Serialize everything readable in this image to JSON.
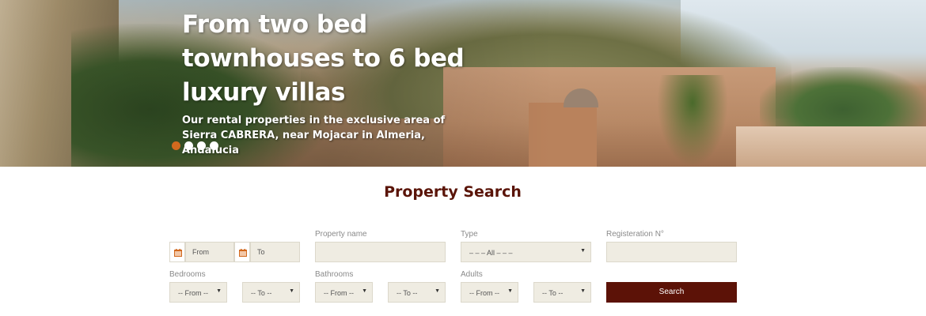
{
  "hero": {
    "title": "From two bed townhouses to 6 bed luxury villas",
    "subtitle": "Our rental properties in the exclusive area of Sierra CABRERA, near Mojacar in Almeria, Andalucia",
    "slides_total": 4,
    "active_slide": 1,
    "dot_active_color": "#d2691e"
  },
  "search": {
    "title": "Property Search",
    "date_from_placeholder": "From",
    "date_to_placeholder": "To",
    "property_name_label": "Property name",
    "property_name_value": "",
    "type_label": "Type",
    "type_value": "– – – All – – –",
    "registration_label": "Registeration N°",
    "registration_value": "",
    "bedrooms_label": "Bedrooms",
    "bedrooms_from": "-- From --",
    "bedrooms_to": "-- To --",
    "bathrooms_label": "Bathrooms",
    "bathrooms_from": "-- From --",
    "bathrooms_to": "-- To --",
    "adults_label": "Adults",
    "adults_from": "-- From --",
    "adults_to": "-- To --",
    "search_button": "Search",
    "accent_color": "#5c1207",
    "field_bg_color": "#efece2"
  }
}
